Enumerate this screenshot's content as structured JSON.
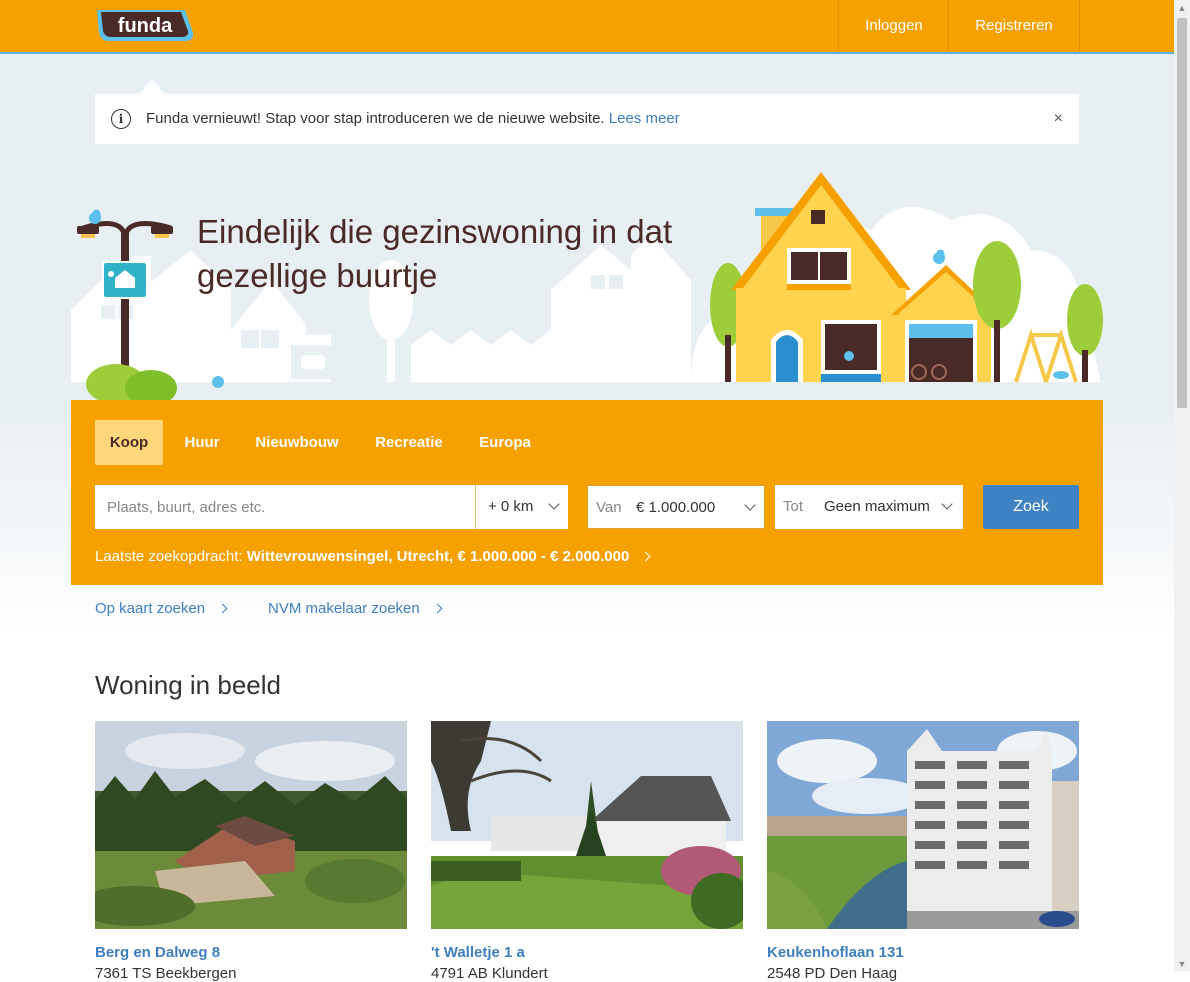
{
  "header": {
    "logo_text": "funda",
    "login": "Inloggen",
    "register": "Registreren"
  },
  "notice": {
    "icon": "info-icon",
    "text": "Funda vernieuwt! Stap voor stap introduceren we de nieuwe website.",
    "link": "Lees meer",
    "close": "×"
  },
  "hero": {
    "title": "Eindelijk die gezinswoning in dat gezellige buurtje"
  },
  "search": {
    "tabs": [
      {
        "label": "Koop",
        "active": true
      },
      {
        "label": "Huur",
        "active": false
      },
      {
        "label": "Nieuwbouw",
        "active": false
      },
      {
        "label": "Recreatie",
        "active": false
      },
      {
        "label": "Europa",
        "active": false
      }
    ],
    "placeholder": "Plaats, buurt, adres etc.",
    "radius": "+ 0 km",
    "van_label": "Van",
    "van_value": "€ 1.000.000",
    "tot_label": "Tot",
    "tot_value": "Geen maximum",
    "button": "Zoek",
    "last_label": "Laatste zoekopdracht:",
    "last_value": "Wittevrouwensingel, Utrecht, € 1.000.000 - € 2.000.000"
  },
  "links": {
    "map": "Op kaart zoeken",
    "nvm": "NVM makelaar zoeken"
  },
  "featured": {
    "title": "Woning in beeld",
    "cards": [
      {
        "address": "Berg en Dalweg 8",
        "city": "7361 TS Beekbergen"
      },
      {
        "address": "'t Walletje 1 a",
        "city": "4791 AB Klundert"
      },
      {
        "address": "Keukenhoflaan 131",
        "city": "2548 PD Den Haag"
      }
    ]
  },
  "colors": {
    "brand": "#f7a100",
    "link": "#3f7fbf",
    "button": "#3f82c4"
  }
}
